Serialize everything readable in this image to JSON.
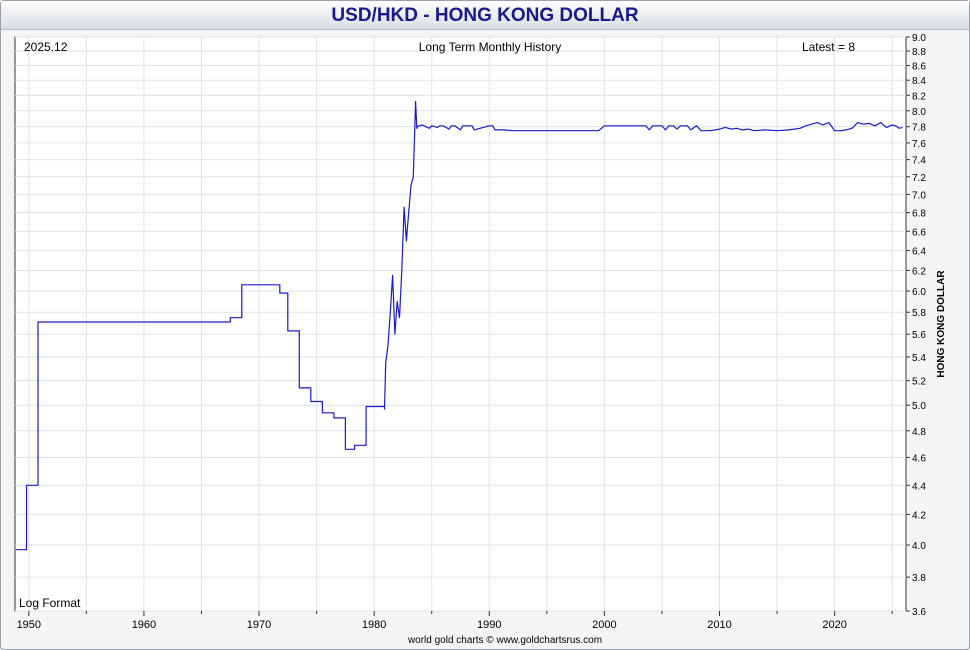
{
  "chart_data": {
    "type": "line",
    "title": "USD/HKD - HONG KONG DOLLAR",
    "subtitle": "Long Term Monthly History",
    "date_label": "2025.12",
    "latest_label": "Latest = 8",
    "scale_note": "Log Format",
    "ylabel": "HONG KONG DOLLAR",
    "footer": "world gold charts © www.goldchartsrus.com",
    "log_scale": true,
    "grid": true,
    "xlim": [
      1948.8,
      2026.2
    ],
    "ylim": [
      3.6,
      9.0
    ],
    "x_ticks": [
      1950,
      1960,
      1970,
      1980,
      1990,
      2000,
      2010,
      2020
    ],
    "y_ticks": [
      3.6,
      3.8,
      4.0,
      4.2,
      4.4,
      4.6,
      4.8,
      5.0,
      5.2,
      5.4,
      5.6,
      5.8,
      6.0,
      6.2,
      6.4,
      6.6,
      6.8,
      7.0,
      7.2,
      7.4,
      7.6,
      7.8,
      8.0,
      8.2,
      8.4,
      8.6,
      8.8,
      9.0
    ],
    "series": [
      {
        "color": "#1a1acc",
        "x": [
          1948.9,
          1949.8,
          1949.8,
          1950.8,
          1950.8,
          1967.5,
          1967.5,
          1968.5,
          1968.5,
          1971.8,
          1971.8,
          1972.5,
          1972.5,
          1973.5,
          1973.5,
          1974.5,
          1974.5,
          1975.5,
          1975.5,
          1976.5,
          1976.5,
          1977.5,
          1977.5,
          1978.3,
          1978.3,
          1979.3,
          1979.3,
          1980.9,
          1980.9,
          1981.0,
          1981.2,
          1981.4,
          1981.6,
          1981.8,
          1982.0,
          1982.2,
          1982.4,
          1982.6,
          1982.8,
          1983.0,
          1983.2,
          1983.4,
          1983.6,
          1983.7,
          1983.85,
          1984.0,
          1984.2,
          1984.8,
          1985.0,
          1985.5,
          1985.7,
          1986.0,
          1986.5,
          1986.7,
          1987.0,
          1987.5,
          1987.7,
          1988.5,
          1988.7,
          1990.0,
          1990.3,
          1990.5,
          1991.0,
          1991.3,
          1992.0,
          1999.5,
          2000.0,
          2003.6,
          2003.9,
          2004.2,
          2005.0,
          2005.3,
          2005.6,
          2006.0,
          2006.3,
          2006.6,
          2007.2,
          2007.5,
          2008.0,
          2008.4,
          2009.2,
          2010.0,
          2010.5,
          2011.0,
          2011.5,
          2012.0,
          2012.5,
          2013.0,
          2014.0,
          2015.0,
          2016.0,
          2017.0,
          2017.5,
          2018.0,
          2018.5,
          2019.0,
          2019.5,
          2020.0,
          2020.3,
          2020.6,
          2021.0,
          2021.5,
          2022.0,
          2022.5,
          2023.0,
          2023.5,
          2024.0,
          2024.5,
          2025.0,
          2025.3,
          2025.6,
          2025.9
        ],
        "y": [
          3.97,
          3.97,
          4.4,
          4.4,
          5.71,
          5.71,
          5.75,
          5.75,
          6.06,
          6.06,
          5.98,
          5.98,
          5.63,
          5.63,
          5.14,
          5.14,
          5.03,
          5.03,
          4.94,
          4.94,
          4.9,
          4.9,
          4.66,
          4.66,
          4.69,
          4.69,
          4.99,
          4.99,
          4.97,
          5.35,
          5.5,
          5.8,
          6.15,
          5.6,
          5.9,
          5.75,
          6.2,
          6.86,
          6.5,
          6.8,
          7.1,
          7.2,
          8.12,
          7.78,
          7.81,
          7.81,
          7.82,
          7.78,
          7.81,
          7.79,
          7.81,
          7.81,
          7.77,
          7.81,
          7.81,
          7.76,
          7.81,
          7.81,
          7.76,
          7.81,
          7.81,
          7.76,
          7.76,
          7.76,
          7.75,
          7.75,
          7.81,
          7.81,
          7.76,
          7.81,
          7.81,
          7.76,
          7.81,
          7.81,
          7.77,
          7.81,
          7.81,
          7.76,
          7.81,
          7.75,
          7.75,
          7.77,
          7.79,
          7.77,
          7.78,
          7.76,
          7.77,
          7.75,
          7.76,
          7.75,
          7.76,
          7.78,
          7.81,
          7.83,
          7.85,
          7.82,
          7.85,
          7.75,
          7.75,
          7.75,
          7.76,
          7.78,
          7.85,
          7.83,
          7.84,
          7.81,
          7.85,
          7.79,
          7.82,
          7.81,
          7.78,
          7.79
        ]
      }
    ]
  }
}
